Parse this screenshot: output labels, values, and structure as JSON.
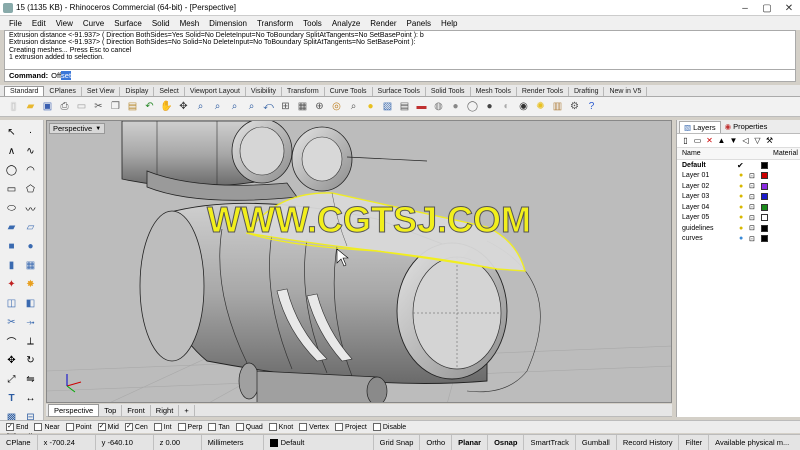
{
  "window": {
    "title": "15 (1135 KB) - Rhinoceros Commercial (64-bit) - [Perspective]"
  },
  "menu": [
    "File",
    "Edit",
    "View",
    "Curve",
    "Surface",
    "Solid",
    "Mesh",
    "Dimension",
    "Transform",
    "Tools",
    "Analyze",
    "Render",
    "Panels",
    "Help"
  ],
  "command_history": [
    "Extrusion distance <-91.937> ( Direction  BothSides=Yes  Solid=No  DeleteInput=No  ToBoundary  SplitAtTangents=No  SetBasePoint ): b",
    "Extrusion distance <-91.937> ( Direction  BothSides=No  Solid=No  DeleteInput=No  ToBoundary  SplitAtTangents=No  SetBasePoint ):",
    "Creating meshes... Press Esc to cancel",
    "1 extrusion added to selection."
  ],
  "command_line": {
    "prompt": "Command:",
    "typed": "Off",
    "selected": "set"
  },
  "toolbar_tabs": [
    "Standard",
    "CPlanes",
    "Set View",
    "Display",
    "Select",
    "Viewport Layout",
    "Visibility",
    "Transform",
    "Curve Tools",
    "Surface Tools",
    "Solid Tools",
    "Mesh Tools",
    "Render Tools",
    "Drafting",
    "New in V5"
  ],
  "viewport": {
    "title": "Perspective",
    "watermark": "WWW.CGTSJ.COM",
    "tabs": [
      "Perspective",
      "Top",
      "Front",
      "Right"
    ],
    "add_tab": "+"
  },
  "panel": {
    "tabs": [
      "Layers",
      "Properties"
    ],
    "columns": {
      "name": "Name",
      "material": "Material"
    },
    "layers": [
      {
        "name": "Default",
        "color": "#000000",
        "current": true
      },
      {
        "name": "Layer 01",
        "color": "#cc0000"
      },
      {
        "name": "Layer 02",
        "color": "#8a2be2"
      },
      {
        "name": "Layer 03",
        "color": "#1a1acc"
      },
      {
        "name": "Layer 04",
        "color": "#1a8a1a"
      },
      {
        "name": "Layer 05",
        "color": "#ffffff"
      },
      {
        "name": "guidelines",
        "color": "#000000"
      },
      {
        "name": "curves",
        "color": "#000000"
      }
    ]
  },
  "osnaps": [
    {
      "label": "End",
      "checked": true
    },
    {
      "label": "Near",
      "checked": false
    },
    {
      "label": "Point",
      "checked": false
    },
    {
      "label": "Mid",
      "checked": true
    },
    {
      "label": "Cen",
      "checked": true
    },
    {
      "label": "Int",
      "checked": false
    },
    {
      "label": "Perp",
      "checked": false
    },
    {
      "label": "Tan",
      "checked": false
    },
    {
      "label": "Quad",
      "checked": false
    },
    {
      "label": "Knot",
      "checked": false
    },
    {
      "label": "Vertex",
      "checked": false
    },
    {
      "label": "Project",
      "checked": false
    },
    {
      "label": "Disable",
      "checked": false
    }
  ],
  "status": {
    "cplane": "CPlane",
    "x": "x -700.24",
    "y": "y -640.10",
    "z": "z 0.00",
    "units": "Millimeters",
    "layer": "Default",
    "grid_snap": "Grid Snap",
    "ortho": "Ortho",
    "planar": "Planar",
    "osnap": "Osnap",
    "smarttrack": "SmartTrack",
    "gumball": "Gumball",
    "record_history": "Record History",
    "filter": "Filter",
    "memory": "Available physical m..."
  }
}
